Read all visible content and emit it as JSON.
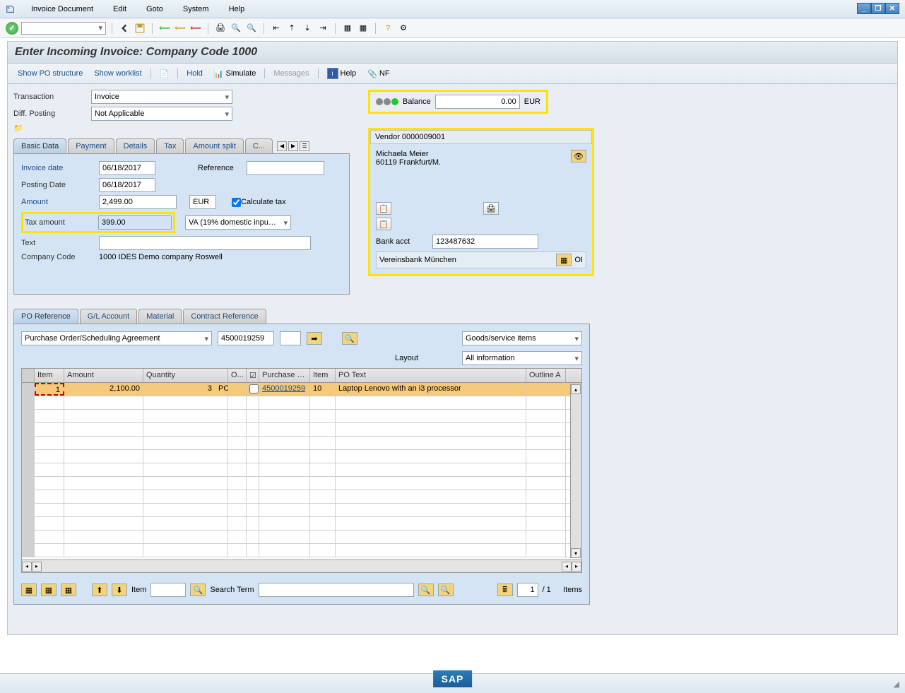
{
  "menu": {
    "items": [
      "Invoice Document",
      "Edit",
      "Goto",
      "System",
      "Help"
    ]
  },
  "title": "Enter Incoming Invoice: Company Code 1000",
  "actions": {
    "po_structure": "Show PO structure",
    "worklist": "Show worklist",
    "hold": "Hold",
    "simulate": "Simulate",
    "messages": "Messages",
    "help": "Help",
    "nf": "NF"
  },
  "transaction": {
    "label": "Transaction",
    "value": "Invoice"
  },
  "diff_posting": {
    "label": "Diff. Posting",
    "value": "Not Applicable"
  },
  "balance": {
    "label": "Balance",
    "value": "0.00",
    "currency": "EUR"
  },
  "tabs1": [
    "Basic Data",
    "Payment",
    "Details",
    "Tax",
    "Amount split",
    "C..."
  ],
  "basic": {
    "invoice_date": {
      "label": "Invoice date",
      "value": "06/18/2017"
    },
    "posting_date": {
      "label": "Posting Date",
      "value": "06/18/2017"
    },
    "reference": {
      "label": "Reference",
      "value": ""
    },
    "amount": {
      "label": "Amount",
      "value": "2,499.00",
      "currency": "EUR"
    },
    "calc_tax": "Calculate tax",
    "tax_amount": {
      "label": "Tax amount",
      "value": "399.00"
    },
    "tax_code": "VA (19% domestic inpu…",
    "text": {
      "label": "Text",
      "value": ""
    },
    "company": {
      "label": "Company Code",
      "value": "1000 IDES Demo company Roswell"
    }
  },
  "vendor": {
    "header": "Vendor 0000009001",
    "name": "Michaela Meier",
    "addr": "60119 Frankfurt/M.",
    "bank_label": "Bank acct",
    "bank_acct": "123487632",
    "bank_name": "Vereinsbank München",
    "oi": "OI"
  },
  "tabs2": [
    "PO Reference",
    "G/L Account",
    "Material",
    "Contract Reference"
  ],
  "po": {
    "ref_type": "Purchase Order/Scheduling Agreement",
    "po_number": "4500019259",
    "item_type": "Goods/service items",
    "layout_label": "Layout",
    "layout": "All information",
    "cols": [
      "Item",
      "Amount",
      "Quantity",
      "O...",
      "",
      "Purchase …",
      "Item",
      "PO Text",
      "Outline A"
    ],
    "row": {
      "item": "1",
      "amount": "2,100.00",
      "qty": "3",
      "uom": "PC",
      "po": "4500019259",
      "po_item": "10",
      "text": "Laptop Lenovo with an i3 processor"
    }
  },
  "footer": {
    "item_label": "Item",
    "search_label": "Search Term",
    "page": "1",
    "page_total": "/ 1",
    "items": "Items"
  }
}
